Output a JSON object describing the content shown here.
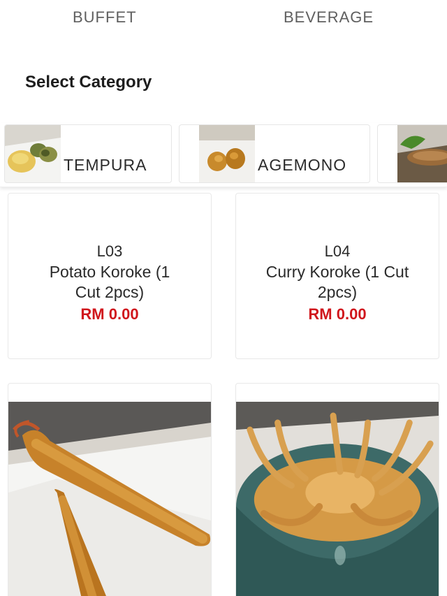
{
  "top_tabs": [
    "BUFFET",
    "BEVERAGE"
  ],
  "section_title": "Select Category",
  "categories": [
    {
      "label": "TEMPURA"
    },
    {
      "label": "AGEMONO"
    },
    {
      "label": ""
    }
  ],
  "items": [
    {
      "code": "L03",
      "name": "Potato Koroke (1 Cut 2pcs)",
      "price": "RM 0.00"
    },
    {
      "code": "L04",
      "name": "Curry Koroke (1 Cut 2pcs)",
      "price": "RM 0.00"
    },
    {
      "image": "fried-prawn-photo"
    },
    {
      "image": "soft-shell-crab-photo"
    }
  ],
  "colors": {
    "price": "#d0161c",
    "tab_text": "#5f5f5f"
  }
}
